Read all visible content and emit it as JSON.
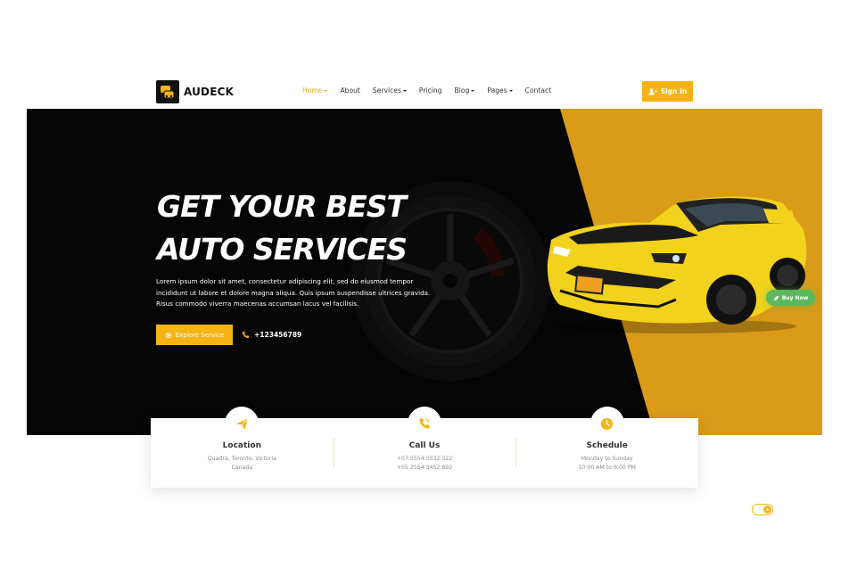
{
  "brand": {
    "name": "AUDECK",
    "accent": "#f5b315",
    "logo_icon": "car-service-logo-icon"
  },
  "nav": {
    "items": [
      {
        "label": "Home",
        "dropdown": true,
        "active": true
      },
      {
        "label": "About",
        "dropdown": false
      },
      {
        "label": "Services",
        "dropdown": true
      },
      {
        "label": "Pricing",
        "dropdown": false
      },
      {
        "label": "Blog",
        "dropdown": true
      },
      {
        "label": "Pages",
        "dropdown": true
      },
      {
        "label": "Contact",
        "dropdown": false
      }
    ],
    "signin_label": "Sign In",
    "signin_icon": "user-plus-icon"
  },
  "hero": {
    "title_line1": "GET YOUR BEST",
    "title_line2": "AUTO SERVICES",
    "description": "Lorem ipsum dolor sit amet, consectetur adipiscing elit, sed do eiusmod tempor incididunt ut labore et dolore magna aliqua. Quis ipsum suspendisse ultrices gravida. Risus commodo viverra maecenas accumsan lacus vel facilisis.",
    "explore_label": "Explore Service",
    "phone": "+123456789",
    "buy_now_label": "Buy Now",
    "colors": {
      "background": "#050505",
      "panel": "#d99b18",
      "car": "#f2d21c"
    }
  },
  "info": [
    {
      "title": "Location",
      "lines": [
        "Quadra, Toronto, Victoria",
        "Canada"
      ],
      "icon": "paper-plane-icon"
    },
    {
      "title": "Call Us",
      "lines": [
        "+07 5554 3332 322",
        "+05 2554 3452 892"
      ],
      "icon": "phone-icon"
    },
    {
      "title": "Schedule",
      "lines": [
        "Monday to Sunday",
        "10:00 AM to 6:00 PM"
      ],
      "icon": "clock-icon"
    }
  ],
  "theme_toggle": {
    "icon": "sun-icon"
  }
}
